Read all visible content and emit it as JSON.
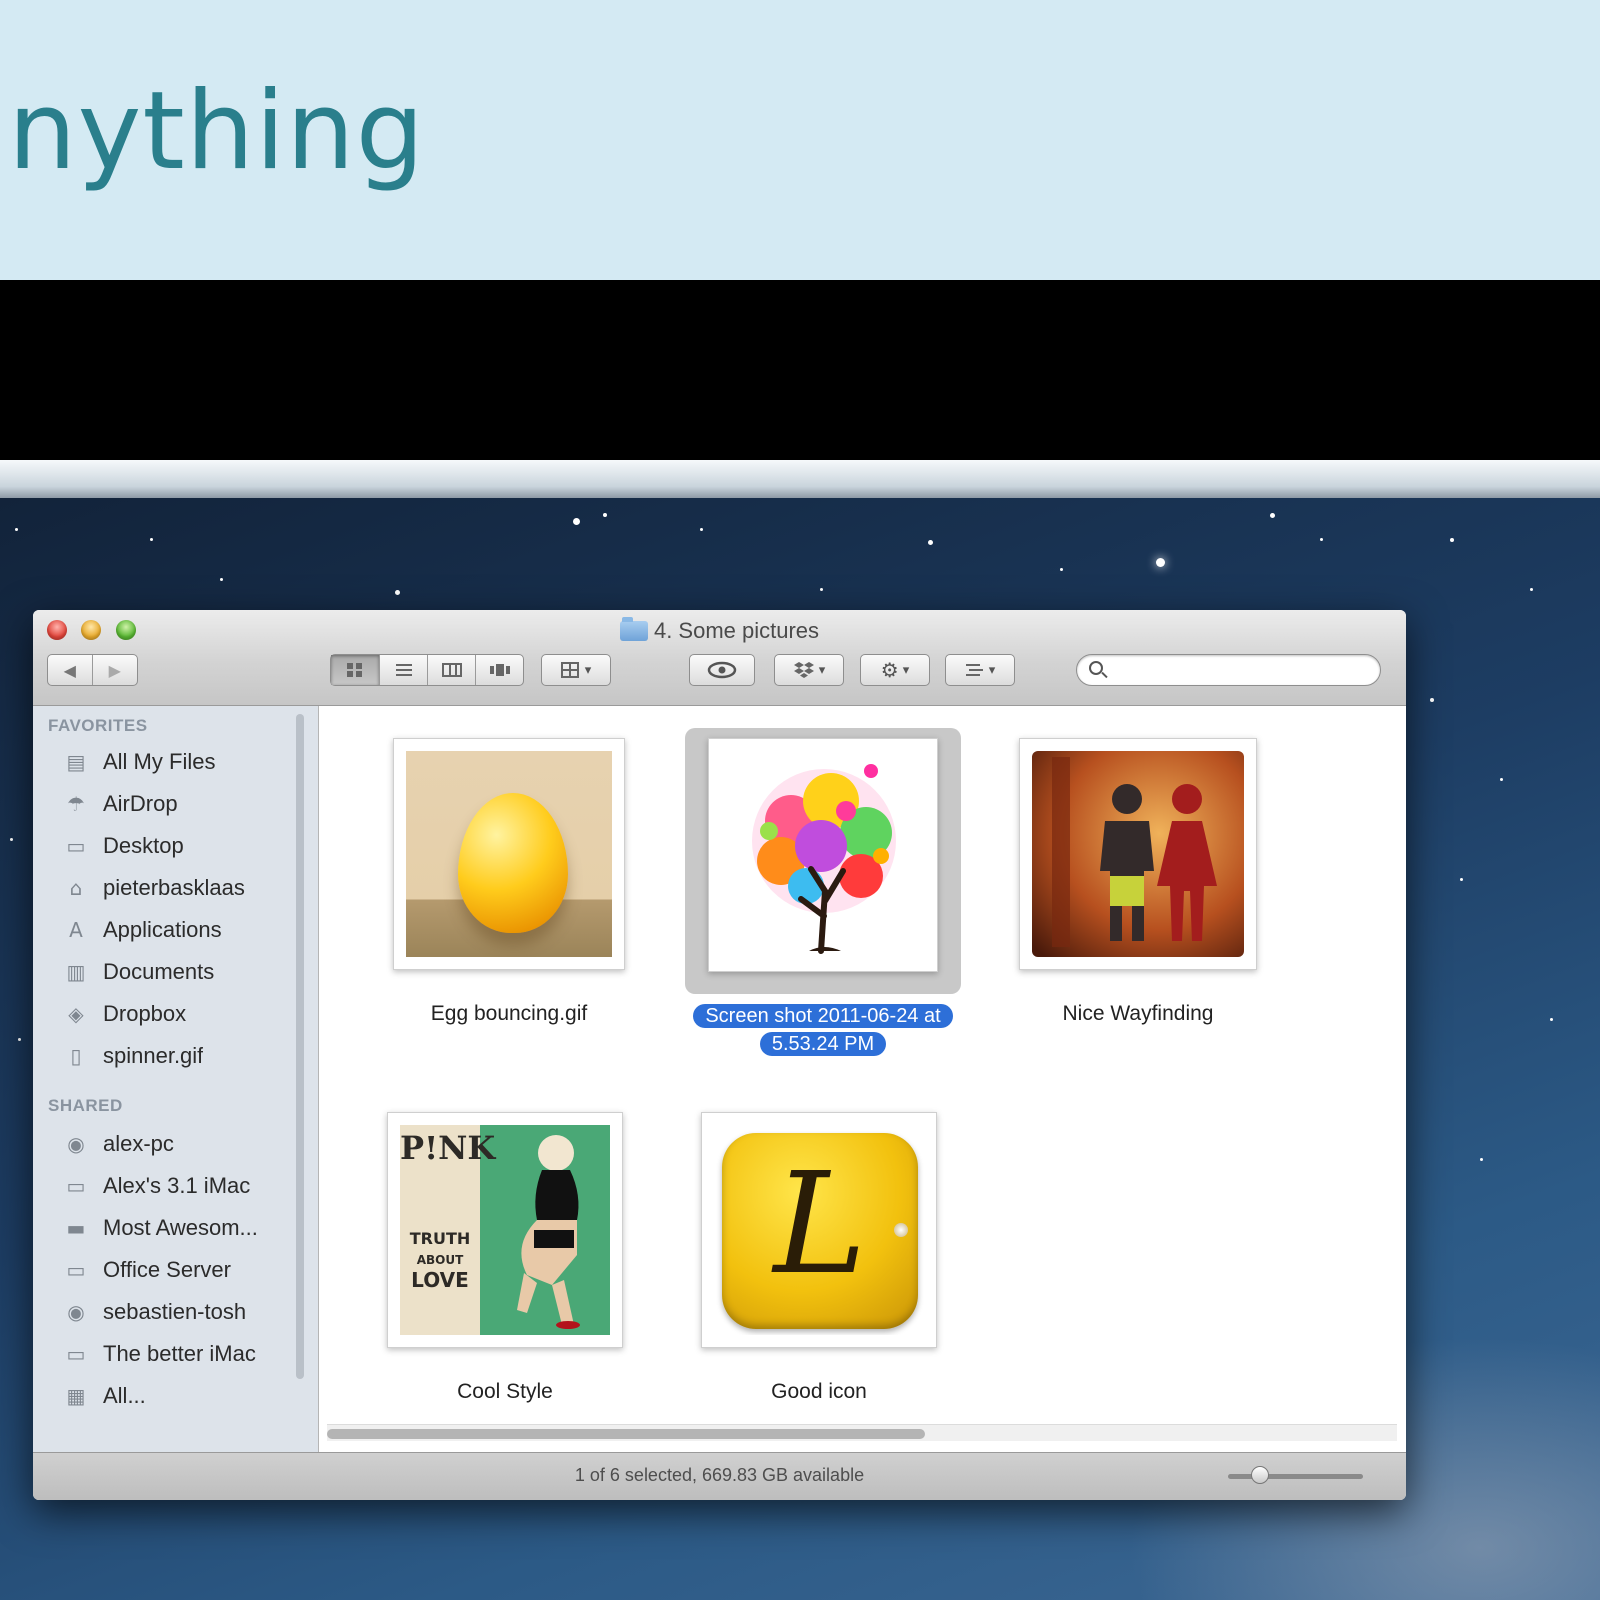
{
  "banner": {
    "title": "nything"
  },
  "window": {
    "title": "4. Some pictures"
  },
  "toolbar": {
    "back": "◀",
    "forward": "▶",
    "view_icons": "icon-view-icon",
    "arrange_caret": "▾",
    "search_placeholder": ""
  },
  "sidebar": {
    "favorites_header": "FAVORITES",
    "favorites": [
      {
        "label": "All My Files",
        "icon": "all-files-icon"
      },
      {
        "label": "AirDrop",
        "icon": "airdrop-icon"
      },
      {
        "label": "Desktop",
        "icon": "desktop-icon"
      },
      {
        "label": "pieterbasklaas",
        "icon": "home-icon"
      },
      {
        "label": "Applications",
        "icon": "applications-icon"
      },
      {
        "label": "Documents",
        "icon": "documents-icon"
      },
      {
        "label": "Dropbox",
        "icon": "dropbox-icon"
      },
      {
        "label": "spinner.gif",
        "icon": "file-icon"
      }
    ],
    "shared_header": "SHARED",
    "shared": [
      {
        "label": "alex-pc",
        "icon": "pc-icon"
      },
      {
        "label": "Alex's 3.1 iMac",
        "icon": "imac-icon"
      },
      {
        "label": "Most Awesom...",
        "icon": "server-icon"
      },
      {
        "label": "Office Server",
        "icon": "server-icon"
      },
      {
        "label": "sebastien-tosh",
        "icon": "pc-icon"
      },
      {
        "label": "The better iMac",
        "icon": "imac-icon"
      },
      {
        "label": "All...",
        "icon": "network-icon"
      }
    ]
  },
  "files": [
    {
      "name": "Egg bouncing.gif",
      "selected": false
    },
    {
      "name": "Screen shot 2011-06-24 at",
      "name_line2": "5.53.24 PM",
      "selected": true
    },
    {
      "name": "Nice Wayfinding",
      "selected": false
    },
    {
      "name": "Cool Style",
      "selected": false
    },
    {
      "name": "Good icon",
      "selected": false
    }
  ],
  "thumb_text": {
    "pink": "P!NK",
    "truth1": "TRUTH",
    "truth2": "ABOUT",
    "truth3": "LOVE",
    "letter": "L"
  },
  "status": {
    "text": "1 of 6 selected, 669.83 GB available",
    "zoom": 0.17
  },
  "colors": {
    "selection": "#2d6fd8",
    "banner": "#d4eaf3",
    "banner_text": "#2a7f8c"
  }
}
